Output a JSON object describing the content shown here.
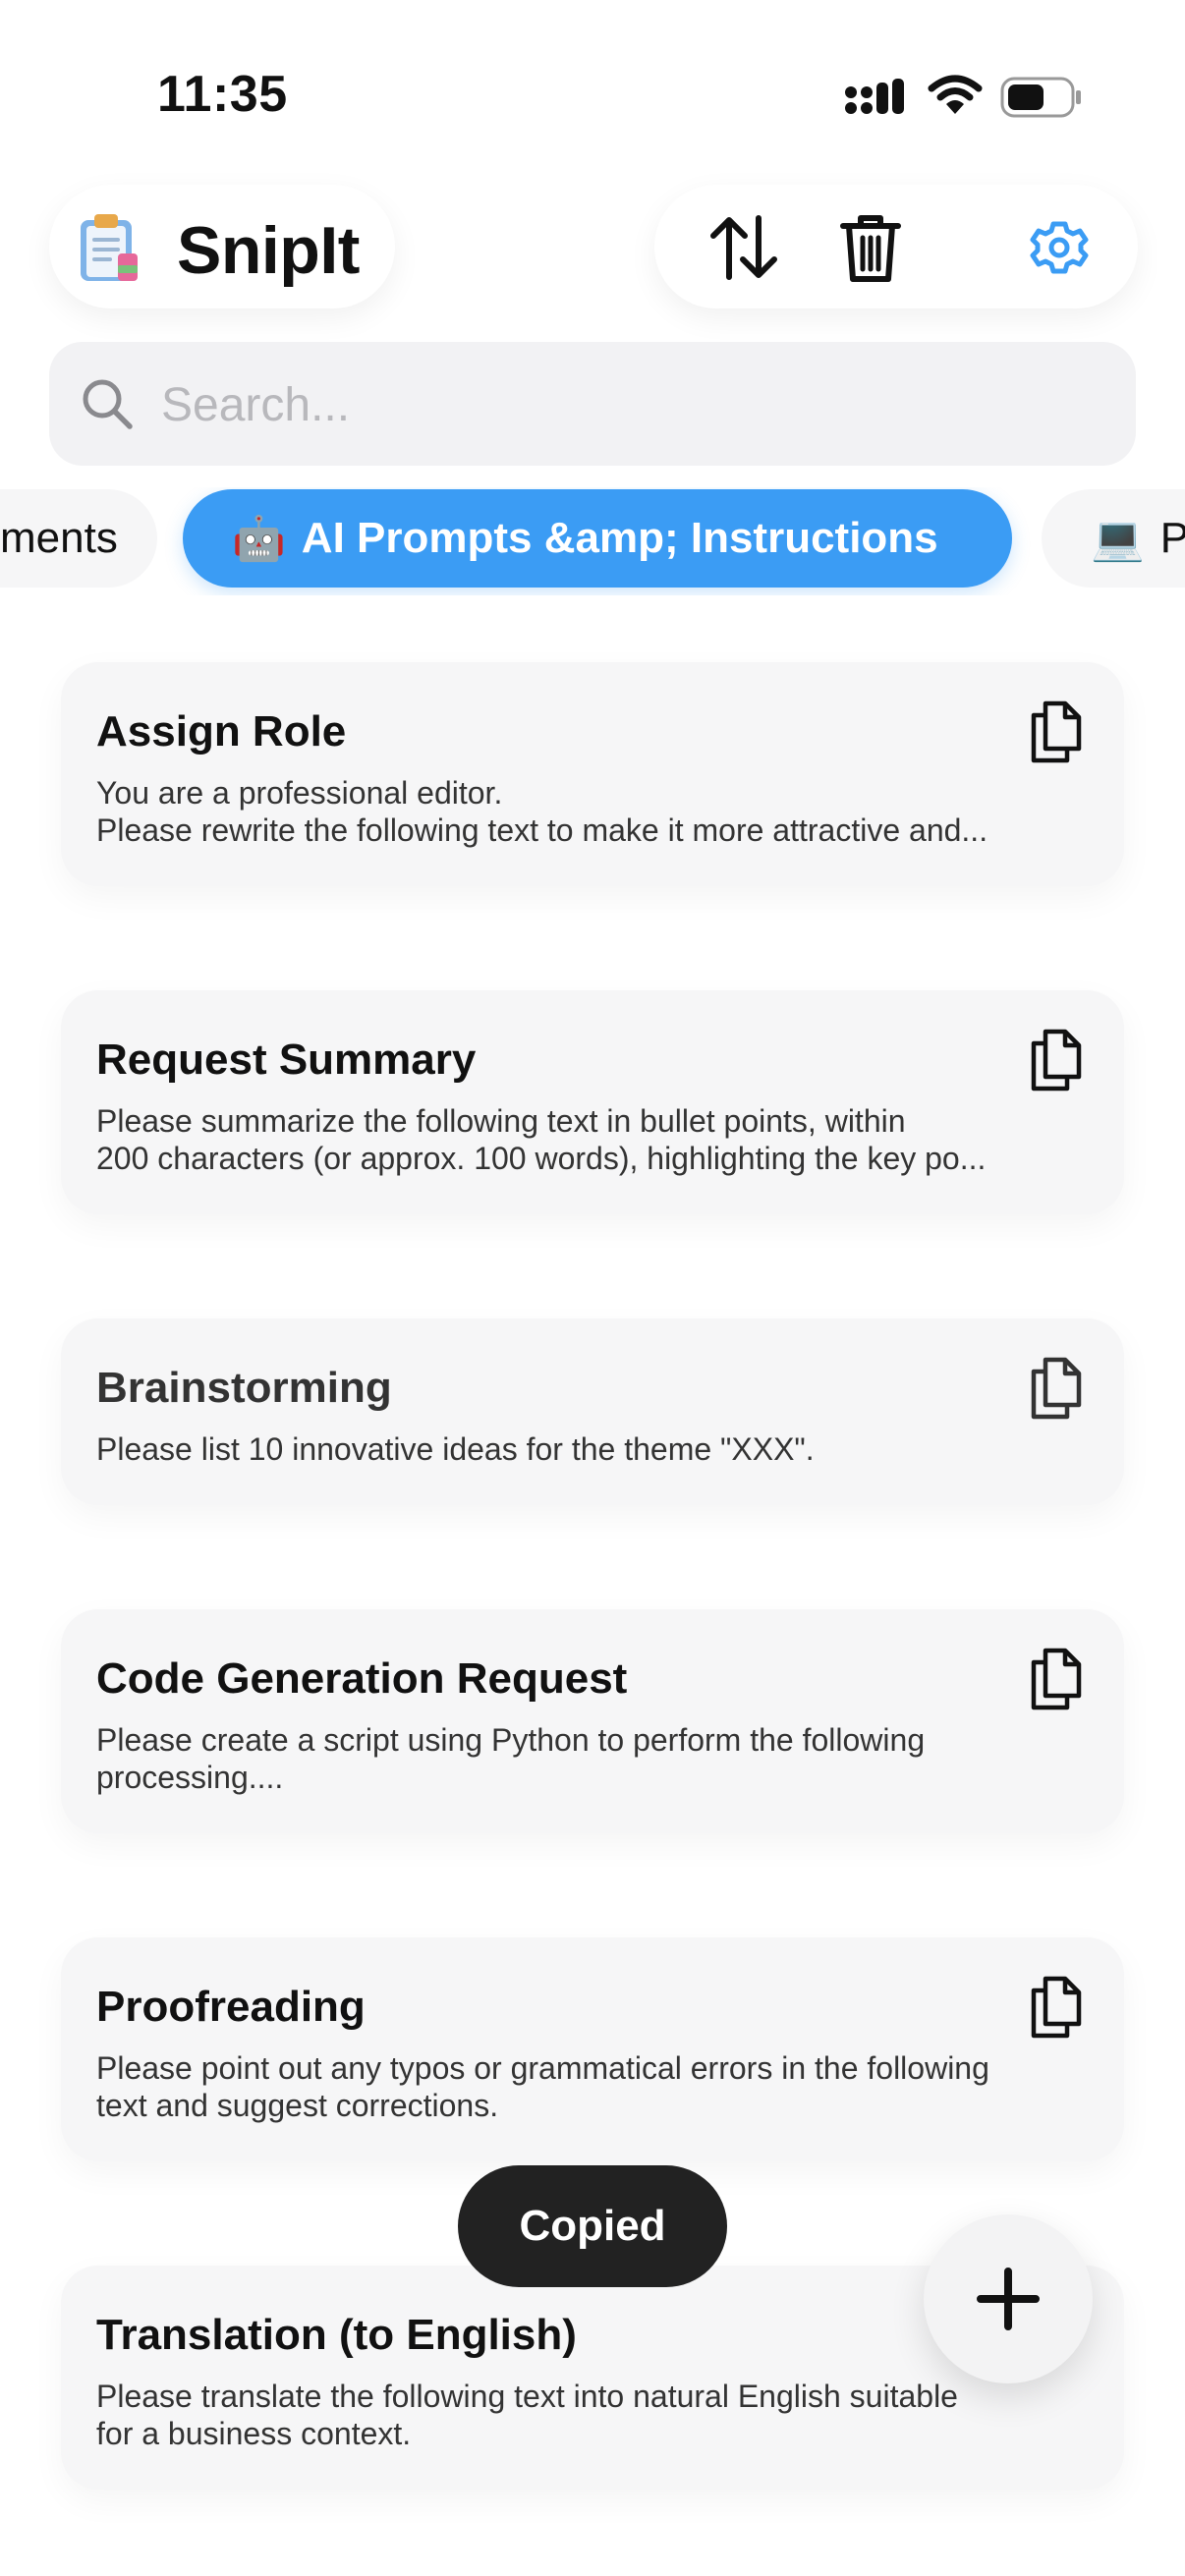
{
  "status_bar": {
    "time": "11:35"
  },
  "header": {
    "app_title": "SnipIt",
    "logo_icon": "clipboard-icon",
    "toolbar": {
      "sort_icon": "sort-arrows-icon",
      "delete_icon": "trash-icon",
      "settings_icon": "gear-icon"
    }
  },
  "search": {
    "placeholder": "Search...",
    "value": ""
  },
  "categories": {
    "previous_label": "ments",
    "active": {
      "emoji": "🤖",
      "label": "AI Prompts &amp; Instructions"
    },
    "next": {
      "emoji": "💻",
      "label": "P"
    }
  },
  "snippets": [
    {
      "title": "Assign Role",
      "lines": [
        "You are a professional editor.",
        "Please rewrite the following text to make it more attractive and..."
      ]
    },
    {
      "title": "Request Summary",
      "lines": [
        "Please summarize the following text in bullet points, within",
        "200 characters (or approx. 100 words), highlighting the key po..."
      ]
    },
    {
      "title": "Brainstorming",
      "lines": [
        "Please list 10 innovative ideas for the theme \"XXX\"."
      ]
    },
    {
      "title": "Code Generation Request",
      "lines": [
        "Please create a script using Python to perform the following",
        "processing...."
      ]
    },
    {
      "title": "Proofreading",
      "lines": [
        "Please point out any typos or grammatical errors in the following",
        "text and suggest corrections."
      ]
    },
    {
      "title": "Translation (to English)",
      "lines": [
        "Please translate the following text into natural English suitable",
        "for a business context."
      ]
    }
  ],
  "toast": {
    "message": "Copied"
  },
  "colors": {
    "accent": "#3b9cf4",
    "card_bg": "#f6f6f7",
    "toast_bg": "#222222"
  }
}
